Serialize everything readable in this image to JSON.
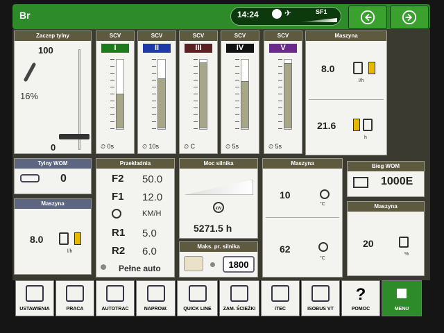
{
  "header": {
    "title": "Br",
    "time": "14:24",
    "signal": "SF1"
  },
  "rear_hitch": {
    "title": "Zaczep tylny",
    "max": "100",
    "min": "0",
    "percent": "16%",
    "level": 0.16
  },
  "scv": [
    {
      "title": "SCV",
      "roman": "I",
      "color": "#1d7a1d",
      "level": 0.48,
      "timer": "0s"
    },
    {
      "title": "SCV",
      "roman": "II",
      "color": "#1e3aa8",
      "level": 0.7,
      "timer": "10s"
    },
    {
      "title": "SCV",
      "roman": "III",
      "color": "#5a2222",
      "level": 0.93,
      "timer": "C"
    },
    {
      "title": "SCV",
      "roman": "IV",
      "color": "#111111",
      "level": 0.66,
      "timer": "5s"
    },
    {
      "title": "SCV",
      "roman": "V",
      "color": "#6a2a8a",
      "level": 0.92,
      "timer": "5s"
    }
  ],
  "machine_top": {
    "title": "Maszyna",
    "val1": "8.0",
    "unit1": "l/h",
    "val2": "21.6",
    "unit2": "h"
  },
  "rear_pto": {
    "title": "Tylny WOM",
    "value": "0"
  },
  "machine_left": {
    "title": "Maszyna",
    "value": "8.0",
    "unit": "l/h"
  },
  "transmission": {
    "title": "Przekładnia",
    "rows": [
      {
        "k": "F2",
        "v": "50.0"
      },
      {
        "k": "F1",
        "v": "12.0"
      },
      {
        "k": "",
        "v": "KM/H"
      },
      {
        "k": "R1",
        "v": "5.0"
      },
      {
        "k": "R2",
        "v": "6.0"
      }
    ],
    "mode": "Pełne auto"
  },
  "engine_power": {
    "title": "Moc silnika",
    "hours": "5271.5 h",
    "kw": "kW"
  },
  "max_engine": {
    "title": "Maks. pr. silnika",
    "value": "1800"
  },
  "machine_mid": {
    "title": "Maszyna",
    "val1": "10",
    "unit1": "°C",
    "val2": "62",
    "unit2": "°C"
  },
  "pto_gear": {
    "title": "Bieg WOM",
    "value": "1000E"
  },
  "machine_right": {
    "title": "Maszyna",
    "value": "20",
    "unit": "%"
  },
  "bottom": [
    "USTAWIENIA",
    "PRACA",
    "AUTOTRAC",
    "NAPROW.",
    "QUICK LINE",
    "ZAM. ŚCIEŻKI",
    "iTEC",
    "ISOBUS VT",
    "POMOC",
    "MENU"
  ]
}
